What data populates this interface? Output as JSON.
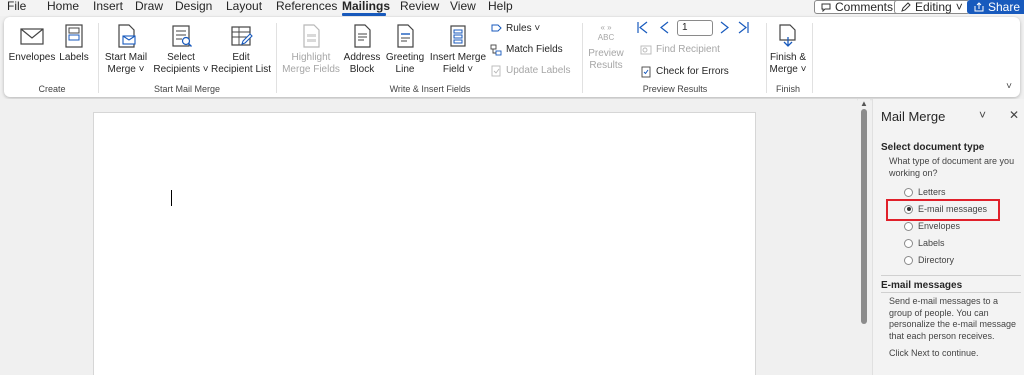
{
  "menu": {
    "items": [
      "File",
      "Home",
      "Insert",
      "Draw",
      "Design",
      "Layout",
      "References",
      "Mailings",
      "Review",
      "View",
      "Help"
    ],
    "active": "Mailings",
    "comments_label": "Comments",
    "editing_label": "Editing",
    "share_label": "Share"
  },
  "ribbon": {
    "create": {
      "group_label": "Create",
      "envelopes": "Envelopes",
      "labels": "Labels"
    },
    "start_mail_merge": {
      "group_label": "Start Mail Merge",
      "start_line1": "Start Mail",
      "start_line2": "Merge ˅",
      "select_line1": "Select",
      "select_line2": "Recipients ˅",
      "edit_line1": "Edit",
      "edit_line2": "Recipient List"
    },
    "write_insert": {
      "group_label": "Write & Insert Fields",
      "highlight_line1": "Highlight",
      "highlight_line2": "Merge Fields",
      "address_line1": "Address",
      "address_line2": "Block",
      "greeting_line1": "Greeting",
      "greeting_line2": "Line",
      "insert_line1": "Insert Merge",
      "insert_line2": "Field ˅",
      "rules": "Rules ˅",
      "match_fields": "Match Fields",
      "update_labels": "Update Labels"
    },
    "preview": {
      "group_label": "Preview Results",
      "abc": "ABC",
      "preview_line1": "Preview",
      "preview_line2": "Results",
      "record_value": "1",
      "find_recipient": "Find Recipient",
      "check_errors": "Check for Errors"
    },
    "finish": {
      "group_label": "Finish",
      "finish_line1": "Finish &",
      "finish_line2": "Merge ˅"
    }
  },
  "pane": {
    "title": "Mail Merge",
    "section1_heading": "Select document type",
    "section1_question": "What type of document are you working on?",
    "options": [
      "Letters",
      "E-mail messages",
      "Envelopes",
      "Labels",
      "Directory"
    ],
    "selected_option": "E-mail messages",
    "section2_heading": "E-mail messages",
    "section2_desc": "Send e-mail messages to a group of people. You can personalize the e-mail message that each person receives.",
    "next_hint": "Click Next to continue."
  },
  "colors": {
    "accent": "#185abd",
    "highlight_box": "#e0202a"
  }
}
